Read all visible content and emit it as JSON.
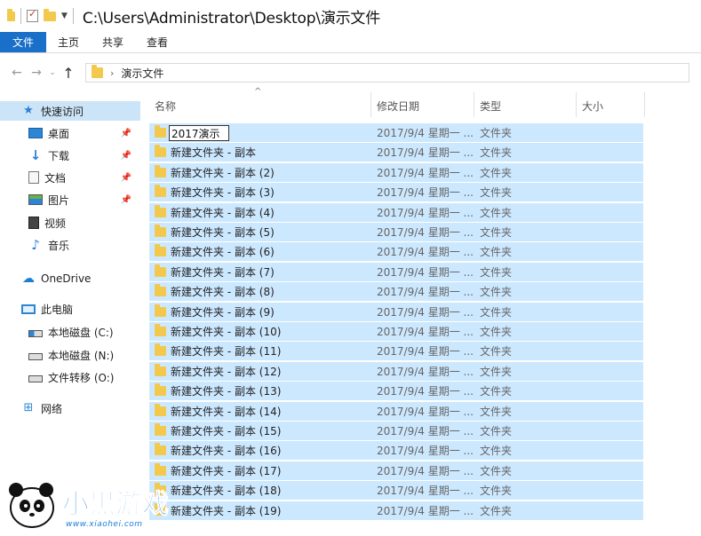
{
  "window": {
    "title": "C:\\Users\\Administrator\\Desktop\\演示文件"
  },
  "ribbon": {
    "tabs": [
      {
        "label": "文件"
      },
      {
        "label": "主页"
      },
      {
        "label": "共享"
      },
      {
        "label": "查看"
      }
    ]
  },
  "address": {
    "path": "演示文件"
  },
  "sidebar": {
    "items": [
      {
        "label": "快速访问",
        "icon": "star-icon",
        "selected": true
      },
      {
        "label": "桌面",
        "icon": "desktop-icon",
        "pinned": true
      },
      {
        "label": "下载",
        "icon": "download-icon",
        "pinned": true
      },
      {
        "label": "文档",
        "icon": "document-icon",
        "pinned": true
      },
      {
        "label": "图片",
        "icon": "pictures-icon",
        "pinned": true
      },
      {
        "label": "视频",
        "icon": "video-icon"
      },
      {
        "label": "音乐",
        "icon": "music-icon"
      },
      {
        "label": "OneDrive",
        "icon": "onedrive-icon"
      },
      {
        "label": "此电脑",
        "icon": "computer-icon"
      },
      {
        "label": "本地磁盘 (C:)",
        "icon": "drive-icon"
      },
      {
        "label": "本地磁盘 (N:)",
        "icon": "drive-icon"
      },
      {
        "label": "文件转移 (O:)",
        "icon": "drive-icon"
      },
      {
        "label": "网络",
        "icon": "network-icon"
      }
    ]
  },
  "columns": {
    "name": "名称",
    "date": "修改日期",
    "type": "类型",
    "size": "大小"
  },
  "rename": {
    "value": "2017演示"
  },
  "files": [
    {
      "name": "2017演示",
      "date": "2017/9/4 星期一 ...",
      "type": "文件夹"
    },
    {
      "name": "新建文件夹 - 副本",
      "date": "2017/9/4 星期一 ...",
      "type": "文件夹"
    },
    {
      "name": "新建文件夹 - 副本 (2)",
      "date": "2017/9/4 星期一 ...",
      "type": "文件夹"
    },
    {
      "name": "新建文件夹 - 副本 (3)",
      "date": "2017/9/4 星期一 ...",
      "type": "文件夹"
    },
    {
      "name": "新建文件夹 - 副本 (4)",
      "date": "2017/9/4 星期一 ...",
      "type": "文件夹"
    },
    {
      "name": "新建文件夹 - 副本 (5)",
      "date": "2017/9/4 星期一 ...",
      "type": "文件夹"
    },
    {
      "name": "新建文件夹 - 副本 (6)",
      "date": "2017/9/4 星期一 ...",
      "type": "文件夹"
    },
    {
      "name": "新建文件夹 - 副本 (7)",
      "date": "2017/9/4 星期一 ...",
      "type": "文件夹"
    },
    {
      "name": "新建文件夹 - 副本 (8)",
      "date": "2017/9/4 星期一 ...",
      "type": "文件夹"
    },
    {
      "name": "新建文件夹 - 副本 (9)",
      "date": "2017/9/4 星期一 ...",
      "type": "文件夹"
    },
    {
      "name": "新建文件夹 - 副本 (10)",
      "date": "2017/9/4 星期一 ...",
      "type": "文件夹"
    },
    {
      "name": "新建文件夹 - 副本 (11)",
      "date": "2017/9/4 星期一 ...",
      "type": "文件夹"
    },
    {
      "name": "新建文件夹 - 副本 (12)",
      "date": "2017/9/4 星期一 ...",
      "type": "文件夹"
    },
    {
      "name": "新建文件夹 - 副本 (13)",
      "date": "2017/9/4 星期一 ...",
      "type": "文件夹"
    },
    {
      "name": "新建文件夹 - 副本 (14)",
      "date": "2017/9/4 星期一 ...",
      "type": "文件夹"
    },
    {
      "name": "新建文件夹 - 副本 (15)",
      "date": "2017/9/4 星期一 ...",
      "type": "文件夹"
    },
    {
      "name": "新建文件夹 - 副本 (16)",
      "date": "2017/9/4 星期一 ...",
      "type": "文件夹"
    },
    {
      "name": "新建文件夹 - 副本 (17)",
      "date": "2017/9/4 星期一 ...",
      "type": "文件夹"
    },
    {
      "name": "新建文件夹 - 副本 (18)",
      "date": "2017/9/4 星期一 ...",
      "type": "文件夹"
    },
    {
      "name": "新建文件夹 - 副本 (19)",
      "date": "2017/9/4 星期一 ...",
      "type": "文件夹"
    }
  ],
  "watermark": {
    "logo_text": "小黑游戏",
    "url": "www.xiaohei.com"
  },
  "colors": {
    "accent": "#1a6fc9",
    "selection": "#cce8ff",
    "sidebar_selection": "#cce4f7",
    "folder": "#f2c94c"
  }
}
